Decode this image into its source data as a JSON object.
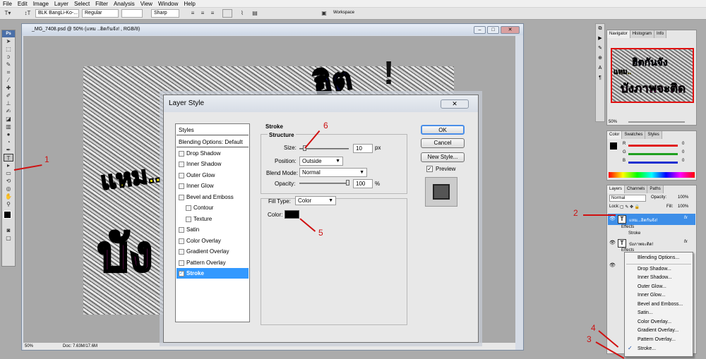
{
  "menubar": [
    "File",
    "Edit",
    "Image",
    "Layer",
    "Select",
    "Filter",
    "Analysis",
    "View",
    "Window",
    "Help"
  ],
  "options_bar": {
    "font_family": "BLK BangLi-Ko-...",
    "font_style": "Regular",
    "font_size": "",
    "anti_alias": "Sharp",
    "workspace": "Workspace"
  },
  "document": {
    "title": "_MG_7408.psd @ 50% (แหม ..ฮิตกันจัง! , RGB/8)",
    "zoom": "50%",
    "doc_info": "Doc: 7.63M/17.6M"
  },
  "panels": {
    "navigator_tabs": [
      "Navigator",
      "Histogram",
      "Info"
    ],
    "navigator_zoom": "50%",
    "color_tabs": [
      "Color",
      "Swatches",
      "Styles"
    ],
    "color_channels": [
      {
        "label": "R",
        "value": "0",
        "color": "#e02020"
      },
      {
        "label": "G",
        "value": "0",
        "color": "#20a020"
      },
      {
        "label": "B",
        "value": "0",
        "color": "#2030d0"
      }
    ],
    "layers_tabs": [
      "Layers",
      "Channels",
      "Paths"
    ],
    "blend_mode": "Normal",
    "opacity_label": "Opacity:",
    "opacity_value": "100%",
    "lock_label": "Lock:",
    "fill_label": "Fill:",
    "fill_value": "100%",
    "layers": [
      {
        "name": "แหม...ฮิตกันจัง!",
        "effects": "Effects",
        "effect": "Stroke"
      },
      {
        "name": "บังภาพจะติด!",
        "effects": "Effects"
      }
    ]
  },
  "dialog": {
    "title": "Layer Style",
    "styles_header": "Styles",
    "blending_options": "Blending Options: Default",
    "style_items": [
      "Drop Shadow",
      "Inner Shadow",
      "Outer Glow",
      "Inner Glow",
      "Bevel and Emboss",
      "Contour",
      "Texture",
      "Satin",
      "Color Overlay",
      "Gradient Overlay",
      "Pattern Overlay",
      "Stroke"
    ],
    "section_title": "Stroke",
    "structure_title": "Structure",
    "size_label": "Size:",
    "size_value": "10",
    "size_unit": "px",
    "position_label": "Position:",
    "position_value": "Outside",
    "blend_label": "Blend Mode:",
    "blend_value": "Normal",
    "opacity_label": "Opacity:",
    "opacity_value": "100",
    "opacity_unit": "%",
    "filltype_label": "Fill Type:",
    "filltype_value": "Color",
    "color_label": "Color:",
    "stroke_color": "#000000",
    "ok": "OK",
    "cancel": "Cancel",
    "new_style": "New Style...",
    "preview": "Preview"
  },
  "context_menu": [
    "Blending Options...",
    "Drop Shadow...",
    "Inner Shadow...",
    "Outer Glow...",
    "Inner Glow...",
    "Bevel and Emboss...",
    "Satin...",
    "Color Overlay...",
    "Gradient Overlay...",
    "Pattern Overlay...",
    "Stroke..."
  ],
  "annotations": [
    "1",
    "2",
    "3",
    "4",
    "5",
    "6"
  ],
  "artwork_text": [
    "แหม..",
    "บัง",
    "ฮิต",
    "!"
  ],
  "thumb_text": [
    "แหม..",
    "ฮิตกันจัง",
    "บังภาพจะติด"
  ]
}
